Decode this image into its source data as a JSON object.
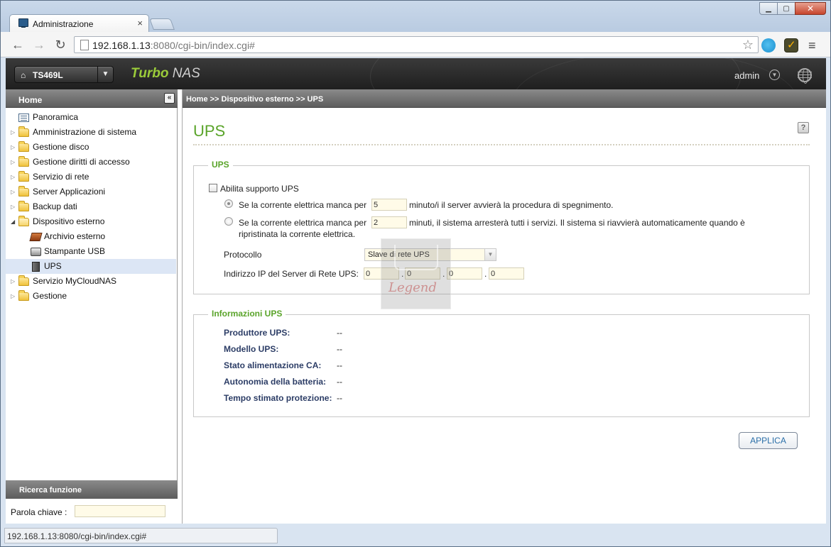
{
  "browser": {
    "tab_title": "Administrazione",
    "tab_close": "×",
    "url_host": "192.168.1.13",
    "url_rest": ":8080/cgi-bin/index.cgi#",
    "status_url": "192.168.1.13:8080/cgi-bin/index.cgi#"
  },
  "header": {
    "device": "TS469L",
    "brand_turbo": "Turbo",
    "brand_nas": " NAS",
    "user": "admin"
  },
  "sidebar": {
    "title": "Home",
    "items": [
      {
        "label": "Panoramica"
      },
      {
        "label": "Amministrazione di sistema"
      },
      {
        "label": "Gestione disco"
      },
      {
        "label": "Gestione diritti di accesso"
      },
      {
        "label": "Servizio di rete"
      },
      {
        "label": "Server Applicazioni"
      },
      {
        "label": "Backup dati"
      },
      {
        "label": "Dispositivo esterno"
      },
      {
        "label": "Archivio esterno"
      },
      {
        "label": "Stampante USB"
      },
      {
        "label": "UPS"
      },
      {
        "label": "Servizio MyCloudNAS"
      },
      {
        "label": "Gestione"
      }
    ],
    "search_title": "Ricerca funzione",
    "search_label": "Parola chiave :"
  },
  "main": {
    "breadcrumb": "Home >> Dispositivo esterno >> UPS",
    "title": "UPS",
    "help": "?",
    "ups_section": {
      "legend": "UPS",
      "enable_label": "Abilita supporto UPS",
      "opt1_prefix": "Se la corrente elettrica manca per",
      "opt1_value": "5",
      "opt1_suffix": "minuto/i il server avvierà la procedura di spegnimento.",
      "opt2_prefix": "Se la corrente elettrica manca per",
      "opt2_value": "2",
      "opt2_suffix": "minuti, il sistema arresterà tutti i servizi. Il sistema si riavvierà automaticamente quando è",
      "opt2_suffix2": "ripristinata la corrente elettrica.",
      "protocol_label": "Protocollo",
      "protocol_value": "Slave di rete UPS",
      "ip_label": "Indirizzo IP del Server di Rete UPS:",
      "ip": [
        "0",
        "0",
        "0",
        "0"
      ],
      "ip_sep": "."
    },
    "info_section": {
      "legend": "Informazioni UPS",
      "rows": [
        {
          "label": "Produttore UPS:",
          "value": "--"
        },
        {
          "label": "Modello UPS:",
          "value": "--"
        },
        {
          "label": "Stato alimentazione CA:",
          "value": "--"
        },
        {
          "label": "Autonomia della batteria:",
          "value": "--"
        },
        {
          "label": "Tempo stimato protezione:",
          "value": "--"
        }
      ]
    },
    "apply_label": "APPLICA"
  },
  "watermark": {
    "text": "Legend"
  }
}
